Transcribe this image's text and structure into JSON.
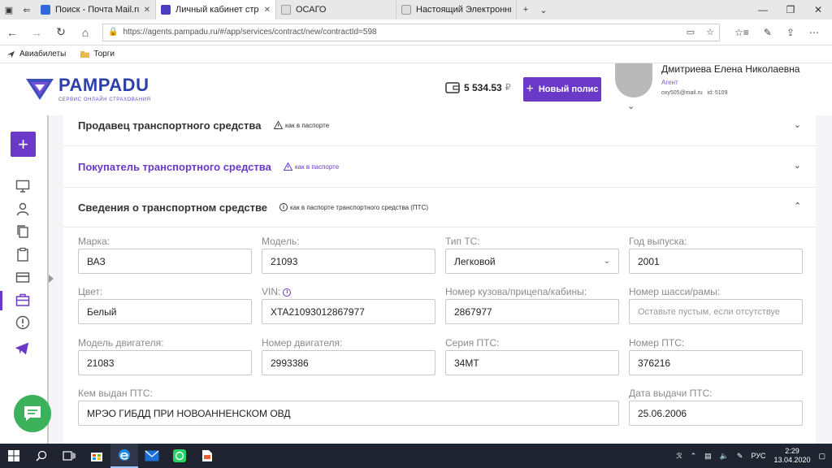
{
  "browser": {
    "tabs": [
      {
        "label": "Поиск - Почта Mail.ru",
        "active": false
      },
      {
        "label": "Личный кабинет страх",
        "active": true
      },
      {
        "label": "ОСАГО",
        "active": false
      },
      {
        "label": "Настоящий Электронный П",
        "active": false
      }
    ],
    "new_tab": "+",
    "url": "https://agents.pampadu.ru/#/app/services/contract/new/contractId=598",
    "bookmarks": [
      {
        "label": "Авиабилеты"
      },
      {
        "label": "Торги"
      }
    ]
  },
  "header": {
    "logo_name": "PAMPADU",
    "logo_tagline": "СЕРВИС ОНЛАЙН СТРАХОВАНИЯ",
    "balance": "5 534.53",
    "currency": "₽",
    "new_policy_label": "Новый полис",
    "user_name": "Дмитриева Елена Николаевна",
    "user_role": "Агент",
    "user_email": "oxy505@mail.ru",
    "user_id": "id: 5109"
  },
  "sections": {
    "seller": {
      "title": "Продавец транспортного средства",
      "hint": "как в паспорте"
    },
    "buyer": {
      "title": "Покупатель транспортного средства",
      "hint": "как в паспорте"
    },
    "vehicle": {
      "title": "Сведения о транспортном средстве",
      "hint": "как в паспорте транспортного средства (ПТС)"
    }
  },
  "fields": {
    "brand": {
      "label": "Марка:",
      "value": "ВАЗ"
    },
    "model": {
      "label": "Модель:",
      "value": "21093"
    },
    "type": {
      "label": "Тип ТС:",
      "value": "Легковой"
    },
    "year": {
      "label": "Год выпуска:",
      "value": "2001"
    },
    "color": {
      "label": "Цвет:",
      "value": "Белый"
    },
    "vin": {
      "label": "VIN:",
      "value": "XTA21093012867977"
    },
    "body_number": {
      "label": "Номер кузова/прицепа/кабины:",
      "value": "2867977"
    },
    "chassis_number": {
      "label": "Номер шасси/рамы:",
      "placeholder": "Оставьте пустым, если отсутствуе"
    },
    "engine_model": {
      "label": "Модель двигателя:",
      "value": "21083"
    },
    "engine_number": {
      "label": "Номер двигателя:",
      "value": "2993386"
    },
    "pts_series": {
      "label": "Серия ПТС:",
      "value": "34МТ"
    },
    "pts_number": {
      "label": "Номер ПТС:",
      "value": "376216"
    },
    "pts_issuer": {
      "label": "Кем выдан ПТС:",
      "value": "МРЭО ГИБДД ПРИ НОВОАННЕНСКОМ ОВД"
    },
    "pts_date": {
      "label": "Дата выдачи ПТС:",
      "value": "25.06.2006"
    }
  },
  "taskbar": {
    "lang": "РУС",
    "time": "2:29",
    "date": "13.04.2020"
  },
  "colors": {
    "accent": "#6a39c8",
    "chat": "#3cb15c",
    "logo": "#2d3fa8"
  }
}
